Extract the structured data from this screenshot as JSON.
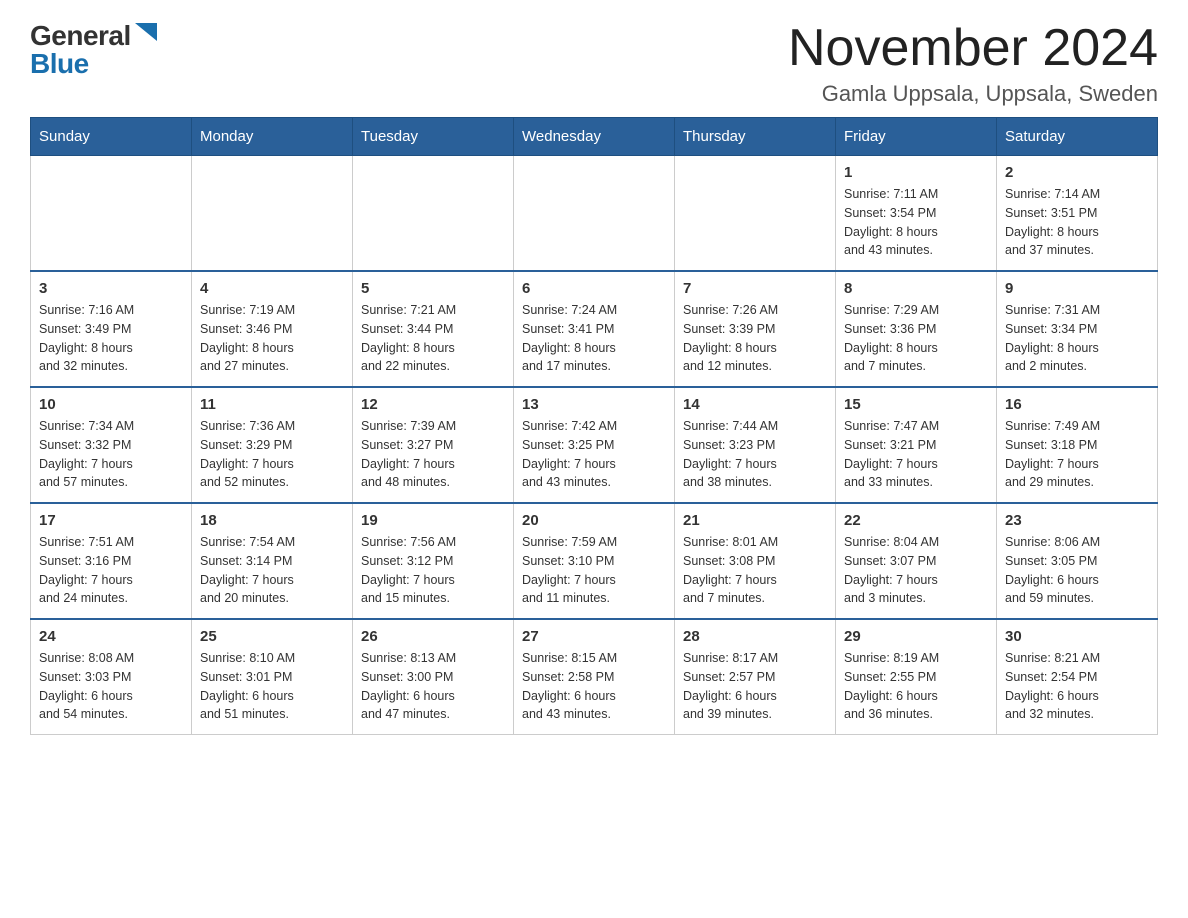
{
  "logo": {
    "general": "General",
    "blue": "Blue"
  },
  "title": "November 2024",
  "location": "Gamla Uppsala, Uppsala, Sweden",
  "days_of_week": [
    "Sunday",
    "Monday",
    "Tuesday",
    "Wednesday",
    "Thursday",
    "Friday",
    "Saturday"
  ],
  "weeks": [
    [
      {
        "day": "",
        "info": ""
      },
      {
        "day": "",
        "info": ""
      },
      {
        "day": "",
        "info": ""
      },
      {
        "day": "",
        "info": ""
      },
      {
        "day": "",
        "info": ""
      },
      {
        "day": "1",
        "info": "Sunrise: 7:11 AM\nSunset: 3:54 PM\nDaylight: 8 hours\nand 43 minutes."
      },
      {
        "day": "2",
        "info": "Sunrise: 7:14 AM\nSunset: 3:51 PM\nDaylight: 8 hours\nand 37 minutes."
      }
    ],
    [
      {
        "day": "3",
        "info": "Sunrise: 7:16 AM\nSunset: 3:49 PM\nDaylight: 8 hours\nand 32 minutes."
      },
      {
        "day": "4",
        "info": "Sunrise: 7:19 AM\nSunset: 3:46 PM\nDaylight: 8 hours\nand 27 minutes."
      },
      {
        "day": "5",
        "info": "Sunrise: 7:21 AM\nSunset: 3:44 PM\nDaylight: 8 hours\nand 22 minutes."
      },
      {
        "day": "6",
        "info": "Sunrise: 7:24 AM\nSunset: 3:41 PM\nDaylight: 8 hours\nand 17 minutes."
      },
      {
        "day": "7",
        "info": "Sunrise: 7:26 AM\nSunset: 3:39 PM\nDaylight: 8 hours\nand 12 minutes."
      },
      {
        "day": "8",
        "info": "Sunrise: 7:29 AM\nSunset: 3:36 PM\nDaylight: 8 hours\nand 7 minutes."
      },
      {
        "day": "9",
        "info": "Sunrise: 7:31 AM\nSunset: 3:34 PM\nDaylight: 8 hours\nand 2 minutes."
      }
    ],
    [
      {
        "day": "10",
        "info": "Sunrise: 7:34 AM\nSunset: 3:32 PM\nDaylight: 7 hours\nand 57 minutes."
      },
      {
        "day": "11",
        "info": "Sunrise: 7:36 AM\nSunset: 3:29 PM\nDaylight: 7 hours\nand 52 minutes."
      },
      {
        "day": "12",
        "info": "Sunrise: 7:39 AM\nSunset: 3:27 PM\nDaylight: 7 hours\nand 48 minutes."
      },
      {
        "day": "13",
        "info": "Sunrise: 7:42 AM\nSunset: 3:25 PM\nDaylight: 7 hours\nand 43 minutes."
      },
      {
        "day": "14",
        "info": "Sunrise: 7:44 AM\nSunset: 3:23 PM\nDaylight: 7 hours\nand 38 minutes."
      },
      {
        "day": "15",
        "info": "Sunrise: 7:47 AM\nSunset: 3:21 PM\nDaylight: 7 hours\nand 33 minutes."
      },
      {
        "day": "16",
        "info": "Sunrise: 7:49 AM\nSunset: 3:18 PM\nDaylight: 7 hours\nand 29 minutes."
      }
    ],
    [
      {
        "day": "17",
        "info": "Sunrise: 7:51 AM\nSunset: 3:16 PM\nDaylight: 7 hours\nand 24 minutes."
      },
      {
        "day": "18",
        "info": "Sunrise: 7:54 AM\nSunset: 3:14 PM\nDaylight: 7 hours\nand 20 minutes."
      },
      {
        "day": "19",
        "info": "Sunrise: 7:56 AM\nSunset: 3:12 PM\nDaylight: 7 hours\nand 15 minutes."
      },
      {
        "day": "20",
        "info": "Sunrise: 7:59 AM\nSunset: 3:10 PM\nDaylight: 7 hours\nand 11 minutes."
      },
      {
        "day": "21",
        "info": "Sunrise: 8:01 AM\nSunset: 3:08 PM\nDaylight: 7 hours\nand 7 minutes."
      },
      {
        "day": "22",
        "info": "Sunrise: 8:04 AM\nSunset: 3:07 PM\nDaylight: 7 hours\nand 3 minutes."
      },
      {
        "day": "23",
        "info": "Sunrise: 8:06 AM\nSunset: 3:05 PM\nDaylight: 6 hours\nand 59 minutes."
      }
    ],
    [
      {
        "day": "24",
        "info": "Sunrise: 8:08 AM\nSunset: 3:03 PM\nDaylight: 6 hours\nand 54 minutes."
      },
      {
        "day": "25",
        "info": "Sunrise: 8:10 AM\nSunset: 3:01 PM\nDaylight: 6 hours\nand 51 minutes."
      },
      {
        "day": "26",
        "info": "Sunrise: 8:13 AM\nSunset: 3:00 PM\nDaylight: 6 hours\nand 47 minutes."
      },
      {
        "day": "27",
        "info": "Sunrise: 8:15 AM\nSunset: 2:58 PM\nDaylight: 6 hours\nand 43 minutes."
      },
      {
        "day": "28",
        "info": "Sunrise: 8:17 AM\nSunset: 2:57 PM\nDaylight: 6 hours\nand 39 minutes."
      },
      {
        "day": "29",
        "info": "Sunrise: 8:19 AM\nSunset: 2:55 PM\nDaylight: 6 hours\nand 36 minutes."
      },
      {
        "day": "30",
        "info": "Sunrise: 8:21 AM\nSunset: 2:54 PM\nDaylight: 6 hours\nand 32 minutes."
      }
    ]
  ]
}
